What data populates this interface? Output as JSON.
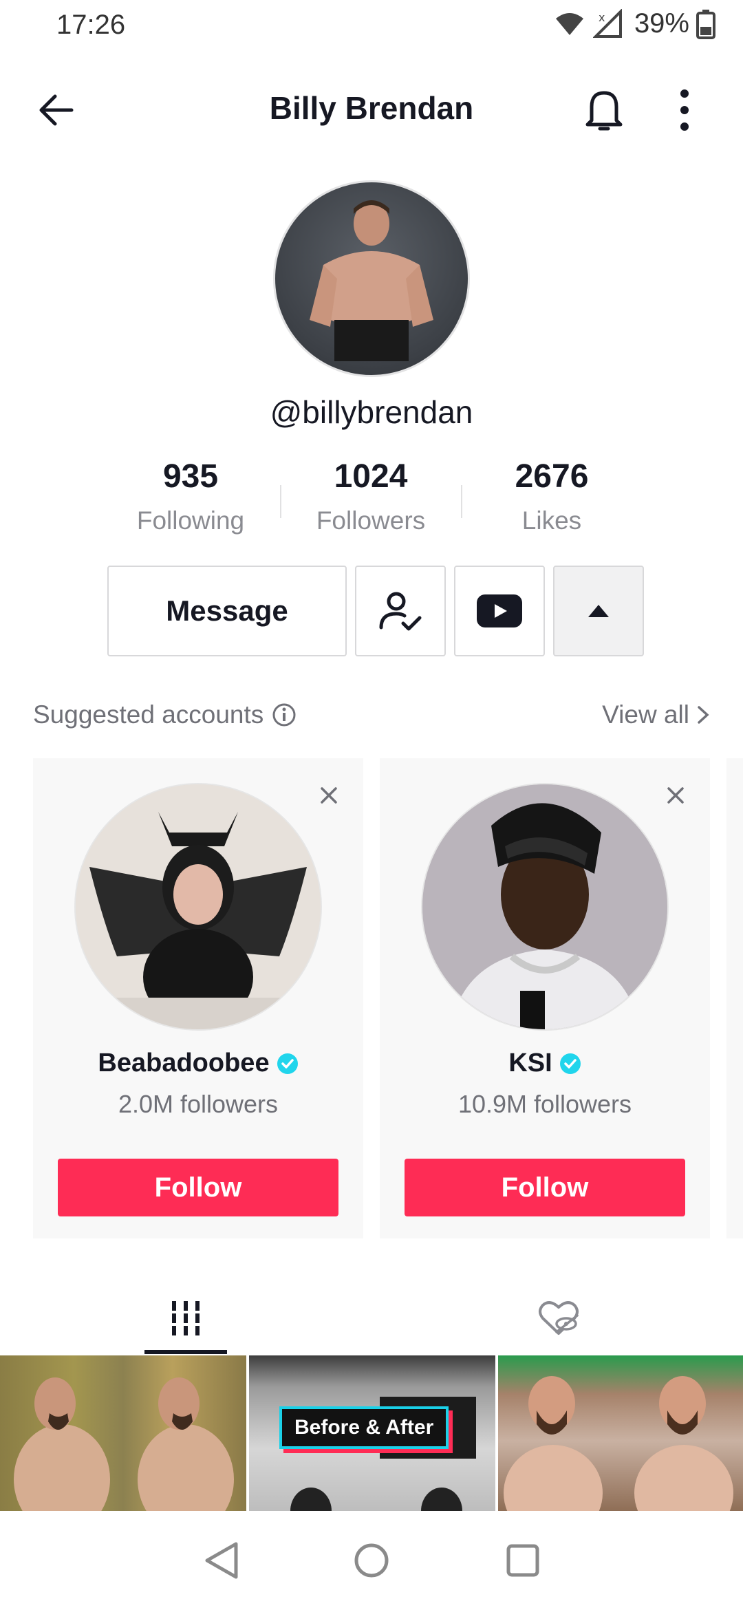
{
  "status_bar": {
    "time": "17:26",
    "battery": "39%"
  },
  "header": {
    "title": "Billy Brendan",
    "icons": [
      "back-arrow-icon",
      "bell-icon",
      "more-vertical-icon"
    ]
  },
  "profile": {
    "username": "@billybrendan"
  },
  "stats": [
    {
      "value": "935",
      "label": "Following"
    },
    {
      "value": "1024",
      "label": "Followers"
    },
    {
      "value": "2676",
      "label": "Likes"
    }
  ],
  "actions": {
    "message_label": "Message"
  },
  "suggested": {
    "title": "Suggested accounts",
    "view_all": "View all",
    "accounts": [
      {
        "name": "Beabadoobee",
        "followers": "2.0M followers",
        "verified": true,
        "follow_label": "Follow"
      },
      {
        "name": "KSI",
        "followers": "10.9M followers",
        "verified": true,
        "follow_label": "Follow"
      }
    ]
  },
  "video_thumbs": {
    "thumb2_label": "Before & After"
  },
  "colors": {
    "accent": "#fe2c55",
    "verified": "#20d5ec",
    "text_primary": "#161823",
    "text_secondary": "#8a8b91"
  }
}
